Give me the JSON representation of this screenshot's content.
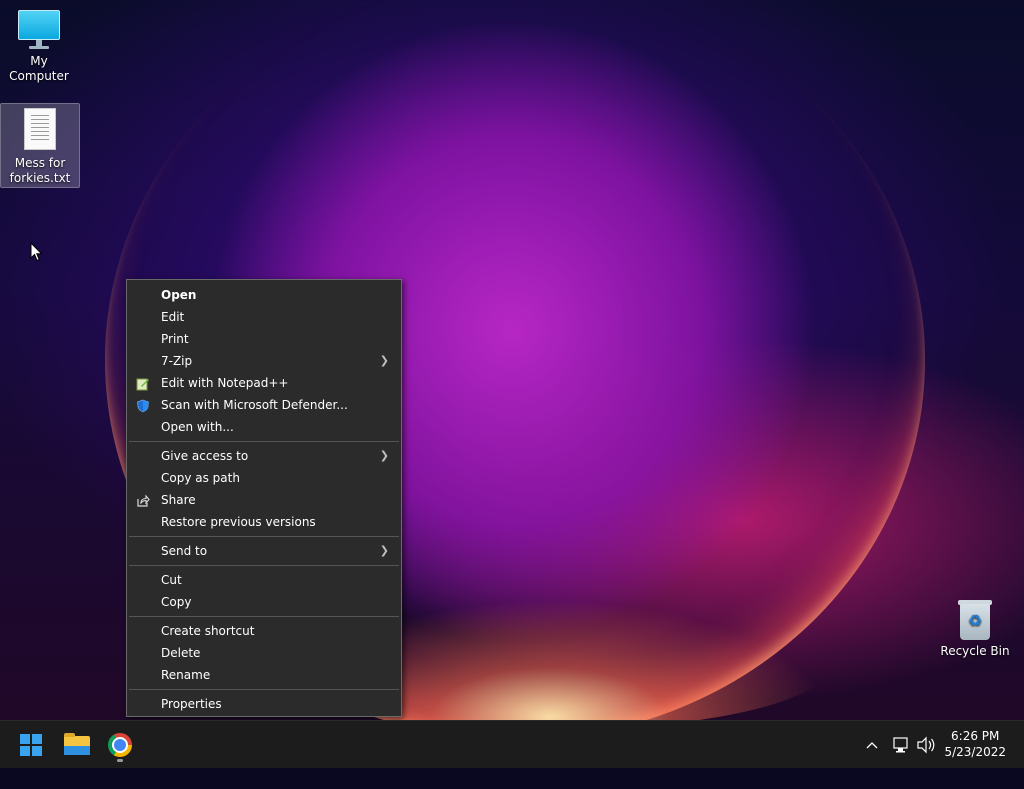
{
  "desktop": {
    "icons": [
      {
        "label": "My Computer"
      },
      {
        "label": "Mess for forkies.txt"
      },
      {
        "label": "Recycle Bin"
      }
    ]
  },
  "context_menu": {
    "items": [
      {
        "label": "Open"
      },
      {
        "label": "Edit"
      },
      {
        "label": "Print"
      },
      {
        "label": "7-Zip"
      },
      {
        "label": "Edit with Notepad++"
      },
      {
        "label": "Scan with Microsoft Defender..."
      },
      {
        "label": "Open with..."
      },
      {
        "label": "Give access to"
      },
      {
        "label": "Copy as path"
      },
      {
        "label": "Share"
      },
      {
        "label": "Restore previous versions"
      },
      {
        "label": "Send to"
      },
      {
        "label": "Cut"
      },
      {
        "label": "Copy"
      },
      {
        "label": "Create shortcut"
      },
      {
        "label": "Delete"
      },
      {
        "label": "Rename"
      },
      {
        "label": "Properties"
      }
    ]
  },
  "taskbar": {
    "apps": [
      "start-icon",
      "file-explorer-icon",
      "chrome-icon"
    ],
    "tray": [
      "chevron-up-icon",
      "network-icon",
      "volume-icon"
    ],
    "clock": {
      "time": "6:26 PM",
      "date": "5/23/2022"
    }
  },
  "colors": {
    "menu_bg": "#2b2b2b",
    "taskbar_bg": "#1c1c1c",
    "accent": "#3aa3f0"
  }
}
